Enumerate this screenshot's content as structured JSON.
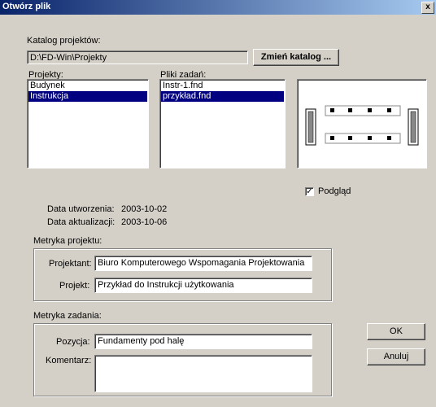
{
  "window": {
    "title": "Otwórz plik",
    "close_glyph": "x"
  },
  "catalog": {
    "label": "Katalog projektów:",
    "path": "D:\\FD-Win\\Projekty",
    "change_button": "Zmień katalog ..."
  },
  "projects": {
    "label": "Projekty:",
    "items": [
      "Budynek",
      "Instrukcja"
    ],
    "selected_index": 1
  },
  "files": {
    "label": "Pliki zadań:",
    "items": [
      "Instr-1.fnd",
      "przykład.fnd"
    ],
    "selected_index": 1
  },
  "preview": {
    "checkbox_label": "Podgląd",
    "checked": true,
    "check_glyph": "✓"
  },
  "dates": {
    "created_label": "Data utworzenia:",
    "created_value": "2003-10-02",
    "updated_label": "Data aktualizacji:",
    "updated_value": "2003-10-06"
  },
  "project_meta": {
    "group_label": "Metryka projektu:",
    "designer_label": "Projektant:",
    "designer_value": "Biuro Komputerowego Wspomagania Projektowania",
    "project_label": "Projekt:",
    "project_value": "Przykład do Instrukcji użytkowania"
  },
  "task_meta": {
    "group_label": "Metryka zadania:",
    "position_label": "Pozycja:",
    "position_value": "Fundamenty pod halę",
    "comment_label": "Komentarz:",
    "comment_value": ""
  },
  "buttons": {
    "ok": "OK",
    "cancel": "Anuluj"
  }
}
